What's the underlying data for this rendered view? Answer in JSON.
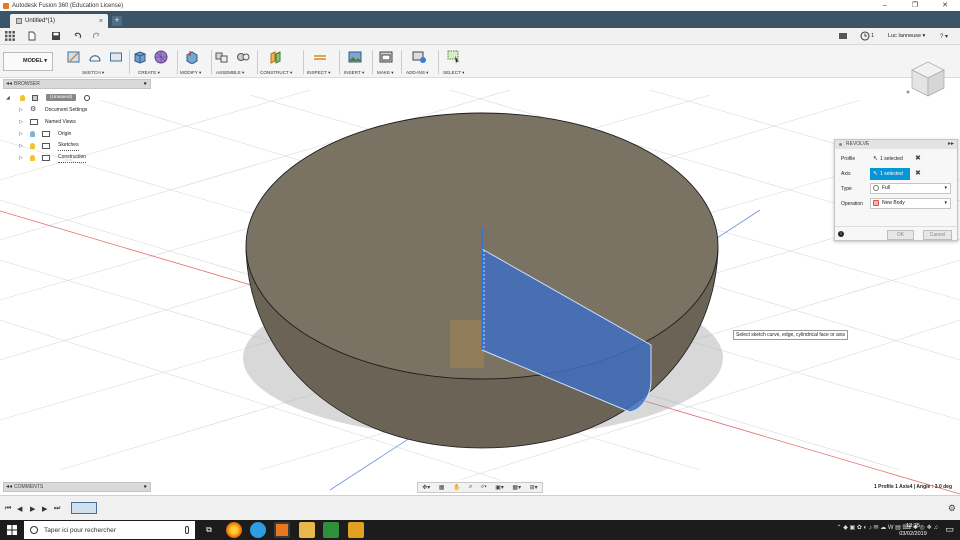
{
  "window": {
    "title": "Autodesk Fusion 360 (Education License)",
    "minimize": "–",
    "maximize": "❐",
    "close": "✕"
  },
  "tabs": [
    {
      "label": "Untitled*(1)",
      "close": "×"
    }
  ],
  "tab_add": "+",
  "quickbar": {
    "jobs_count": "1",
    "user": "Luc Ianneuse ▾",
    "help": "? ▾"
  },
  "toolbar": {
    "workspace": "MODEL ▾",
    "groups": [
      {
        "label": "SKETCH ▾"
      },
      {
        "label": "CREATE ▾"
      },
      {
        "label": "MODIFY ▾"
      },
      {
        "label": "ASSEMBLE ▾"
      },
      {
        "label": "CONSTRUCT ▾"
      },
      {
        "label": "INSPECT ▾"
      },
      {
        "label": "INSERT ▾"
      },
      {
        "label": "MAKE ▾"
      },
      {
        "label": "ADD-INS ▾"
      },
      {
        "label": "SELECT ▾"
      }
    ]
  },
  "browser": {
    "title": "BROWSER",
    "root_label": "(Unsaved)",
    "items": [
      {
        "label": "Document Settings"
      },
      {
        "label": "Named Views"
      },
      {
        "label": "Origin"
      },
      {
        "label": "Sketches"
      },
      {
        "label": "Construction"
      }
    ]
  },
  "revolve": {
    "title": "REVOLVE",
    "profile_label": "Profile",
    "profile_value": "1 selected",
    "axis_label": "Axis",
    "axis_value": "1 selected",
    "type_label": "Type",
    "type_value": "Full",
    "operation_label": "Operation",
    "operation_value": "New Body",
    "ok": "OK",
    "cancel": "Cancel",
    "clear": "✖"
  },
  "tooltip": "Select sketch curve, edge, cylindrical face or axis",
  "comments": {
    "title": "COMMENTS"
  },
  "status": "1 Profile 1 Axis4 | Angle : 3.0 deg",
  "taskbar": {
    "search_placeholder": "Taper ici pour rechercher",
    "time": "13:35",
    "date": "03/02/2019"
  },
  "colors": {
    "tab_bar": "#3b5468",
    "accent": "#0696d7",
    "body": "#6b6355",
    "profile_fill": "#3f6fc0"
  }
}
